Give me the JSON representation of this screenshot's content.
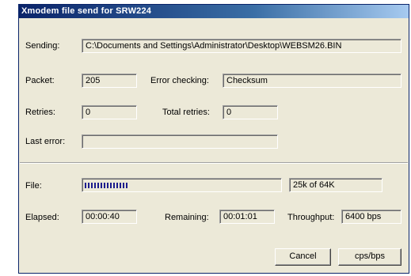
{
  "window": {
    "title": "Xmodem file send for SRW224"
  },
  "sending": {
    "label": "Sending:",
    "value": "C:\\Documents and Settings\\Administrator\\Desktop\\WEBSM26.BIN"
  },
  "packet": {
    "label": "Packet:",
    "value": "205"
  },
  "error_checking": {
    "label": "Error checking:",
    "value": "Checksum"
  },
  "retries": {
    "label": "Retries:",
    "value": "0"
  },
  "total_retries": {
    "label": "Total retries:",
    "value": "0"
  },
  "last_error": {
    "label": "Last error:",
    "value": ""
  },
  "file": {
    "label": "File:",
    "progress_fraction": 0.39,
    "progress_blocks": 14,
    "size_text": "25k of 64K"
  },
  "elapsed": {
    "label": "Elapsed:",
    "value": "00:00:40"
  },
  "remaining": {
    "label": "Remaining:",
    "value": "00:01:01"
  },
  "throughput": {
    "label": "Throughput:",
    "value": "6400 bps"
  },
  "buttons": {
    "cancel": "Cancel",
    "cps_bps": "cps/bps"
  },
  "colors": {
    "titlebar": "#0a246a",
    "progress": "#1c1c8c",
    "dialog_bg": "#ece9d8"
  }
}
